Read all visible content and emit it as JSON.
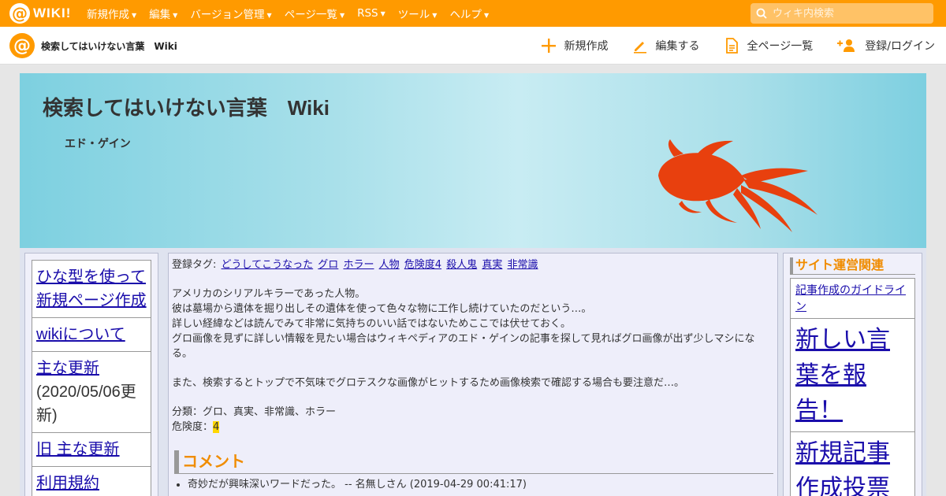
{
  "topbar": {
    "logo_text": "WIKI!",
    "nav": [
      {
        "label": "新規作成"
      },
      {
        "label": "編集"
      },
      {
        "label": "バージョン管理"
      },
      {
        "label": "ページ一覧"
      },
      {
        "label": "RSS"
      },
      {
        "label": "ツール"
      },
      {
        "label": "ヘルプ"
      }
    ],
    "search_placeholder": "ウィキ内検索"
  },
  "subbar": {
    "site_title": "検索してはいけない言葉　Wiki",
    "actions": [
      {
        "label": "新規作成",
        "icon": "plus-icon"
      },
      {
        "label": "編集する",
        "icon": "pencil-icon"
      },
      {
        "label": "全ページ一覧",
        "icon": "document-icon"
      },
      {
        "label": "登録/ログイン",
        "icon": "add-user-icon"
      }
    ]
  },
  "banner": {
    "title": "検索してはいけない言葉　Wiki",
    "page_name": "エド・ゲイン"
  },
  "left_menu": [
    {
      "label": "ひな型を使って新規ページ作成"
    },
    {
      "label": "wikiについて"
    },
    {
      "label": "主な更新",
      "note": "(2020/05/06更新)"
    },
    {
      "label": "旧 主な更新"
    },
    {
      "label": "利用規約"
    }
  ],
  "main": {
    "tags_label": "登録タグ:",
    "tags": [
      "どうしてこうなった",
      "グロ",
      "ホラー",
      "人物",
      "危険度4",
      "殺人鬼",
      "真実",
      "非常識"
    ],
    "paragraph1": [
      "アメリカのシリアルキラーであった人物。",
      "彼は墓場から遺体を掘り出しその遺体を使って色々な物に工作し続けていたのだという…。",
      "詳しい経緯などは読んでみて非常に気持ちのいい話ではないためここでは伏せておく。",
      "グロ画像を見ずに詳しい情報を見たい場合はウィキペディアのエド・ゲインの記事を探して見ればグロ画像が出ず少しマシにな",
      "る。"
    ],
    "paragraph2": "また、検索するとトップで不気味でグロテスクな画像がヒットするため画像検索で確認する場合も要注意だ…。",
    "category_line": "分類：グロ、真実、非常識、ホラー",
    "danger_label": "危険度：",
    "danger_value": "4",
    "comment_heading": "コメント",
    "comments": [
      "奇妙だが興味深いワードだった。 -- 名無しさん (2019-04-29 00:41:17)"
    ]
  },
  "right_menu": {
    "title": "サイト運営関連",
    "items": [
      {
        "label": "記事作成のガイドライン"
      },
      {
        "label": "新しい言葉を報告！"
      },
      {
        "label": "新規記事作成投票"
      }
    ]
  },
  "colors": {
    "topbar": "#ff9a00",
    "accent_heading": "#f08c00",
    "link": "#1a0dab",
    "goldfish": "#e8400e"
  }
}
